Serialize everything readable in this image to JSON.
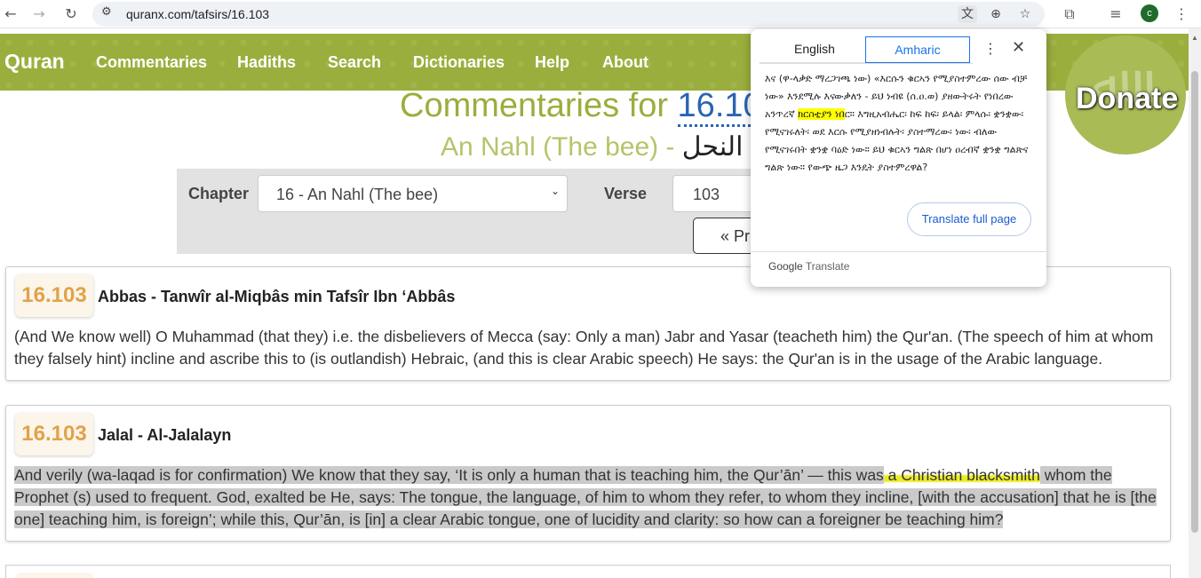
{
  "browser": {
    "url": "quranx.com/tafsirs/16.103",
    "avatar_letter": "c"
  },
  "nav": {
    "brand": "Quran",
    "links": [
      "Commentaries",
      "Hadiths",
      "Search",
      "Dictionaries",
      "Help",
      "About"
    ]
  },
  "heading": {
    "title_prefix": "Commentaries for ",
    "title_ref": "16.10",
    "subtitle": "An Nahl (The bee) - ",
    "subtitle_arabic": "النحل"
  },
  "selector": {
    "chapter_label": "Chapter",
    "chapter_value": "16 - An Nahl (The bee)",
    "verse_label": "Verse",
    "verse_value": "103",
    "prev_label": "« Pr"
  },
  "donate": {
    "label": "Donate"
  },
  "commentaries": [
    {
      "ref": "16.103",
      "source": "Abbas - Tanwîr al-Miqbâs min Tafsîr Ibn ‘Abbâs",
      "lines": [
        "(And We know well) O Muhammad (that they) i.e. the disbelievers of Mecca (say: Only a man) Jabr and Yasar (teacheth him) the Qur'an. (The speech of him at whom",
        "they falsely hint) incline and ascribe this to (is outlandish) Hebraic, (and this is clear Arabic speech) He says: the Qur'an is in the usage of the Arabic language."
      ]
    },
    {
      "ref": "16.103",
      "source": "Jalal - Al-Jalalayn",
      "line1_before": "And verily (wa-laqad is for confirmation) We know that they say, ‘It is only a human that is teaching him, the Qur’ān’ — this was",
      "line1_mark": " a Christian blacksmith",
      "line1_after": " whom the",
      "line2": "Prophet (s) used to frequent. God, exalted be He, says: The tongue, the language, of him to whom they refer, to whom they incline, [with the accusation] that he is [the",
      "line3": "one] teaching him, is foreign’; while this, Qur’ān, is [in] a clear Arabic tongue, one of lucidity and clarity: so how can a foreigner be teaching him?"
    }
  ],
  "translate_popup": {
    "tab_source": "English",
    "tab_target": "Amharic",
    "text_before": "እና (ዋ-ላቃድ ማረጋገጫ ነው) «እርሱን ቁርኣን የሚያስተምረው ሰው ብቻ ነው» እንደሚሉ እናውቃለን - ይህ ነብዩ (ሰ.ዐ.ወ) ያዘውትሩት የነበረው አንጥረኛ ",
    "text_highlight": "ክርስቲያን ነበ",
    "text_after": "ር። እግዚአብሔር፡ ከፍ ከፍ፡ ይላል፡ ምላሱ፡ ቋንቋው፡ የሚናገሩለት፡ ወደ እርሱ የሚያዘነብሉት፡ ያስተማረው፡ ነው፡ ብለው የሚናገሩበት ቋንቋ ባዕድ ነው። ይህ ቁርኣን ግልጽ በሆነ ዐረብኛ ቋንቋ ግልጽና ግልጽ ነው። የውጭ ዜጋ እንዴት ያስተምረዋል?",
    "full_page_button": "Translate full page",
    "brand_google": "Google",
    "brand_translate": "Translate"
  }
}
